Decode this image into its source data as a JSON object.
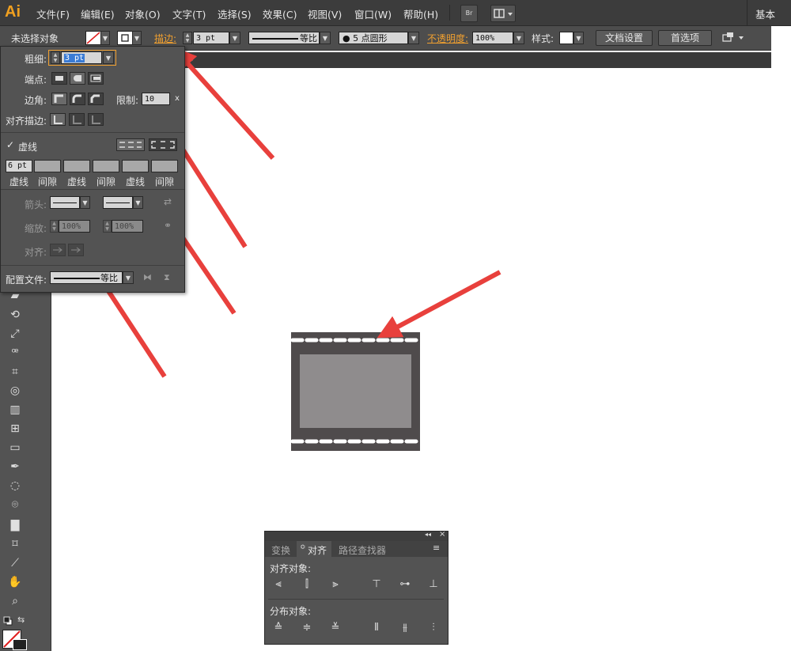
{
  "app": {
    "logo": "Ai",
    "workspace": "基本"
  },
  "menu": [
    "文件(F)",
    "编辑(E)",
    "对象(O)",
    "文字(T)",
    "选择(S)",
    "效果(C)",
    "视图(V)",
    "窗口(W)",
    "帮助(H)"
  ],
  "menu_buttons": {
    "bridge": "Br"
  },
  "control": {
    "selection": "未选择对象",
    "stroke_label": "描边:",
    "stroke_weight": "3 pt",
    "profile": "等比",
    "brush": "5 点圆形",
    "opacity_label": "不透明度:",
    "opacity": "100%",
    "style_label": "样式:",
    "doc_setup": "文档设置",
    "prefs": "首选项"
  },
  "stroke_panel": {
    "weight_label": "粗细:",
    "weight": "3 pt",
    "cap_label": "端点:",
    "corner_label": "边角:",
    "limit_label": "限制:",
    "limit": "10",
    "limit_unit": "x",
    "align_label": "对齐描边:",
    "dashed_label": "虚线",
    "dashed_checked": true,
    "dash_first": "6 pt",
    "dash_labels": [
      "虚线",
      "间隙",
      "虚线",
      "间隙",
      "虚线",
      "间隙"
    ],
    "arrow_label": "箭头:",
    "scale_label": "缩放:",
    "scale1": "100%",
    "scale2": "100%",
    "align2_label": "对齐:",
    "profile_label": "配置文件:",
    "profile_value": "等比"
  },
  "align_panel": {
    "tabs": [
      "变换",
      "对齐",
      "路径查找器"
    ],
    "active_tab": 1,
    "align_objects": "对齐对象:",
    "distribute_objects": "分布对象:"
  },
  "colors": {
    "arrow": "#e8403c",
    "film": "#4f4b4c",
    "film_inner": "#8f8c8d",
    "accent": "#f0a030"
  }
}
